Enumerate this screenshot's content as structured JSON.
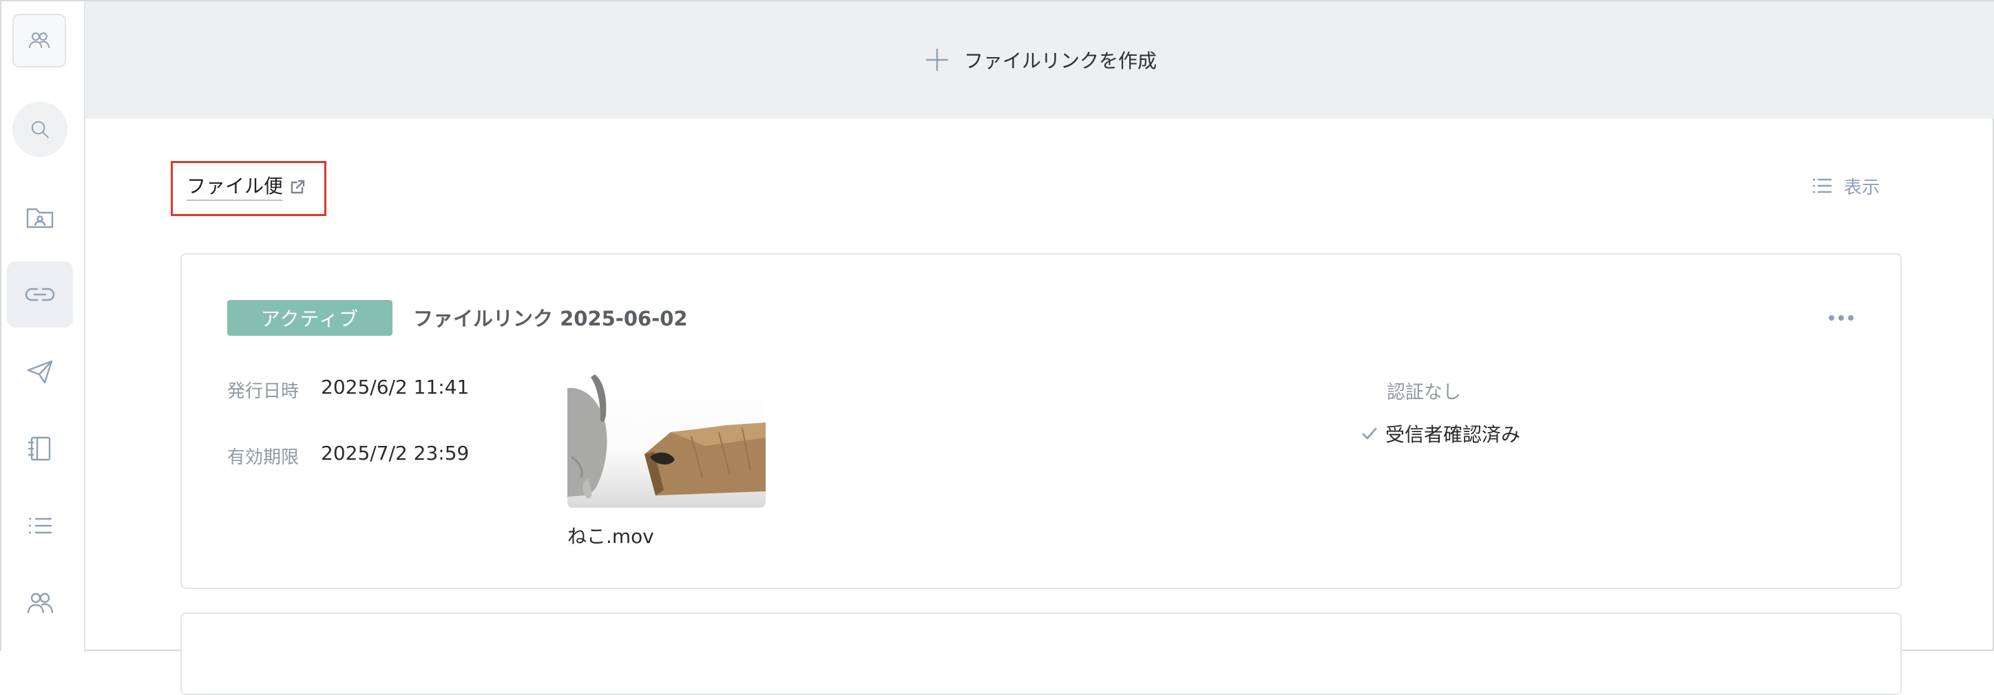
{
  "topbar": {
    "create_label": "ファイルリンクを作成"
  },
  "section": {
    "title": "ファイル便",
    "view_label": "表示"
  },
  "card": {
    "status": "アクティブ",
    "title": "ファイルリンク 2025-06-02",
    "issued_label": "発行日時",
    "issued_value": "2025/6/2 11:41",
    "expiry_label": "有効期限",
    "expiry_value": "2025/7/2 23:59",
    "file_name": "ねこ.mov",
    "auth_label": "認証なし",
    "confirm_label": "受信者確認済み"
  },
  "colors": {
    "accent": "#85bfb1",
    "highlight_border": "#d93a2b",
    "icon": "#8fa0b4"
  },
  "sidebar": {
    "icons": [
      "users-icon",
      "search-icon",
      "folder-user-icon",
      "link-icon",
      "send-icon",
      "address-book-icon",
      "list-icon",
      "team-icon"
    ]
  }
}
